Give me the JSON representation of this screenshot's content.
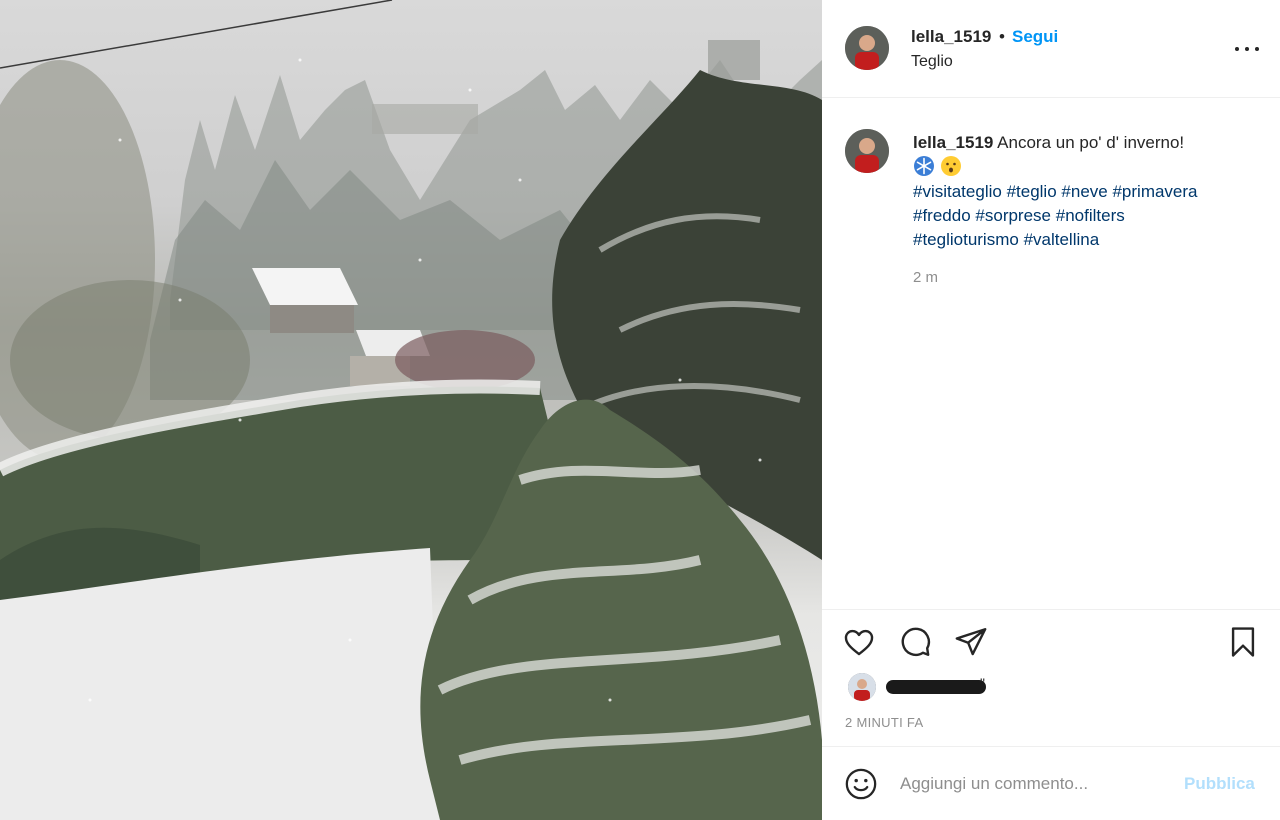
{
  "post": {
    "photo_alt": "",
    "icons": {
      "more": "more-horizontal-icon",
      "like": "heart-icon",
      "comment": "comment-bubble-icon",
      "share": "paper-plane-icon",
      "save": "bookmark-icon",
      "emoji": "smiley-icon"
    }
  },
  "header": {
    "username": "lella_1519",
    "separator": "•",
    "follow_label": "Segui",
    "location": "Teglio"
  },
  "caption": {
    "username": "lella_1519",
    "text": "Ancora un po' d' inverno!",
    "emojis": [
      "snowflake",
      "hushed-face"
    ],
    "hashtags": [
      "#visitateglio",
      "#teglio",
      "#neve",
      "#primavera",
      "#freddo",
      "#sorprese",
      "#nofilters",
      "#teglioturismo",
      "#valtellina"
    ],
    "time": "2 m"
  },
  "likes": {
    "suffix": "\""
  },
  "timestamp": "2 MINUTI FA",
  "comment": {
    "placeholder": "Aggiungi un commento...",
    "publish_label": "Pubblica"
  },
  "colors": {
    "link_blue": "#0095f6",
    "hashtag": "#00376b",
    "publish_disabled": "#b2dffc",
    "muted": "#8e8e8e"
  }
}
